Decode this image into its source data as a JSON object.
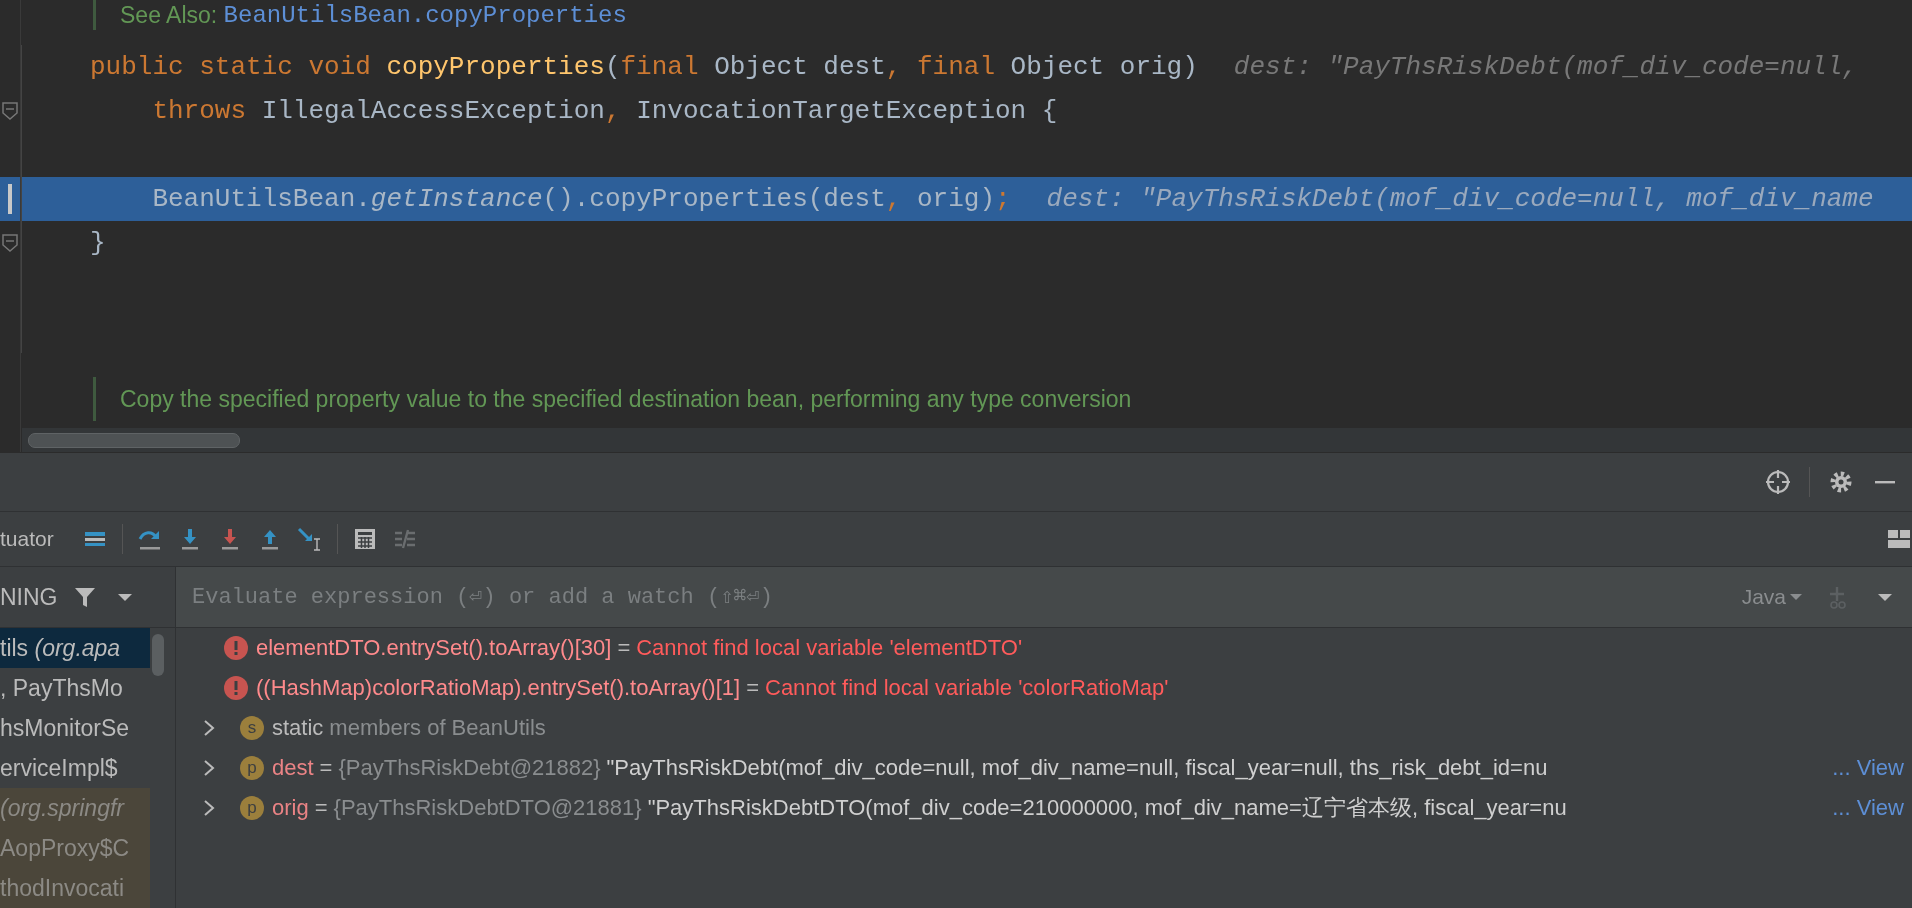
{
  "editor": {
    "lines": [
      {
        "kind": "doc",
        "tokens": [
          {
            "kind": "doc",
            "text": "See Also: "
          },
          {
            "kind": "doclink",
            "text": "BeanUtilsBean.copyProperties"
          }
        ]
      },
      {
        "kind": "code",
        "highlighted": false,
        "fold": false,
        "tokens": [
          {
            "kind": "kw",
            "text": "public static void "
          },
          {
            "kind": "method",
            "text": "copyProperties"
          },
          {
            "kind": "plain",
            "text": "("
          },
          {
            "kind": "kw",
            "text": "final "
          },
          {
            "kind": "plain",
            "text": "Object dest"
          },
          {
            "kind": "kw",
            "text": ", final "
          },
          {
            "kind": "plain",
            "text": "Object orig)"
          }
        ],
        "hint": "dest: \"PayThsRiskDebt(mof_div_code=null,"
      },
      {
        "kind": "code",
        "highlighted": false,
        "fold": true,
        "tokens": [
          {
            "kind": "kw",
            "text": "    throws "
          },
          {
            "kind": "plain",
            "text": "IllegalAccessException"
          },
          {
            "kind": "kw",
            "text": ", "
          },
          {
            "kind": "plain",
            "text": "InvocationTargetException {"
          }
        ]
      },
      {
        "kind": "blank"
      },
      {
        "kind": "code",
        "highlighted": true,
        "fold": false,
        "tokens": [
          {
            "kind": "plain",
            "text": "    BeanUtilsBean."
          },
          {
            "kind": "italic",
            "text": "getInstance"
          },
          {
            "kind": "plain",
            "text": "().copyProperties(dest"
          },
          {
            "kind": "kw",
            "text": ", "
          },
          {
            "kind": "plain",
            "text": "orig)"
          },
          {
            "kind": "kw",
            "text": ";"
          }
        ],
        "hint": "dest: \"PayThsRiskDebt(mof_div_code=null, mof_div_name"
      },
      {
        "kind": "code",
        "highlighted": false,
        "fold": true,
        "tokens": [
          {
            "kind": "plain",
            "text": "}"
          }
        ]
      },
      {
        "kind": "blank"
      },
      {
        "kind": "blank"
      },
      {
        "kind": "doc",
        "tokens": [
          {
            "kind": "doc",
            "text": "Copy the specified property value to the specified destination bean, performing any type conversion"
          }
        ]
      }
    ]
  },
  "debugger": {
    "tab_label": "tuator",
    "frames": {
      "header": "NING",
      "items": [
        {
          "label": "tils *(org.apa*",
          "selected": true,
          "kind": "app"
        },
        {
          "label": ", PayThsMo",
          "selected": false,
          "kind": "app"
        },
        {
          "label": "hsMonitorSe",
          "selected": false,
          "kind": "app"
        },
        {
          "label": "erviceImpl$",
          "selected": false,
          "kind": "app"
        },
        {
          "label": "*(org.springfr*",
          "selected": false,
          "kind": "library"
        },
        {
          "label": "AopProxy$C",
          "selected": false,
          "kind": "library"
        },
        {
          "label": "thodInvocati",
          "selected": false,
          "kind": "library"
        }
      ]
    },
    "watch_field": {
      "placeholder": "Evaluate expression (⏎) or add a watch (⇧⌘⏎)",
      "language": "Java"
    },
    "variables": [
      {
        "kind": "error",
        "name": "elementDTO.entrySet().toArray()[30]",
        "equals": "=",
        "value": "Cannot find local variable 'elementDTO'"
      },
      {
        "kind": "error",
        "name": "((HashMap)colorRatioMap).entrySet().toArray()[1]",
        "equals": "=",
        "value": "Cannot find local variable 'colorRatioMap'"
      },
      {
        "kind": "static",
        "badge": "s",
        "name": "static",
        "value": "members of BeanUtils"
      },
      {
        "kind": "param",
        "badge": "p",
        "name": "dest",
        "equals": "=",
        "type": "{PayThsRiskDebt@21882}",
        "value": "\"PayThsRiskDebt(mof_div_code=null, mof_div_name=null, fiscal_year=null, ths_risk_debt_id=nu",
        "link": "... View"
      },
      {
        "kind": "param",
        "badge": "p",
        "name": "orig",
        "equals": "=",
        "type": "{PayThsRiskDebtDTO@21881}",
        "value": "\"PayThsRiskDebtDTO(mof_div_code=210000000, mof_div_name=辽宁省本级, fiscal_year=nu",
        "link": "... View"
      }
    ]
  }
}
